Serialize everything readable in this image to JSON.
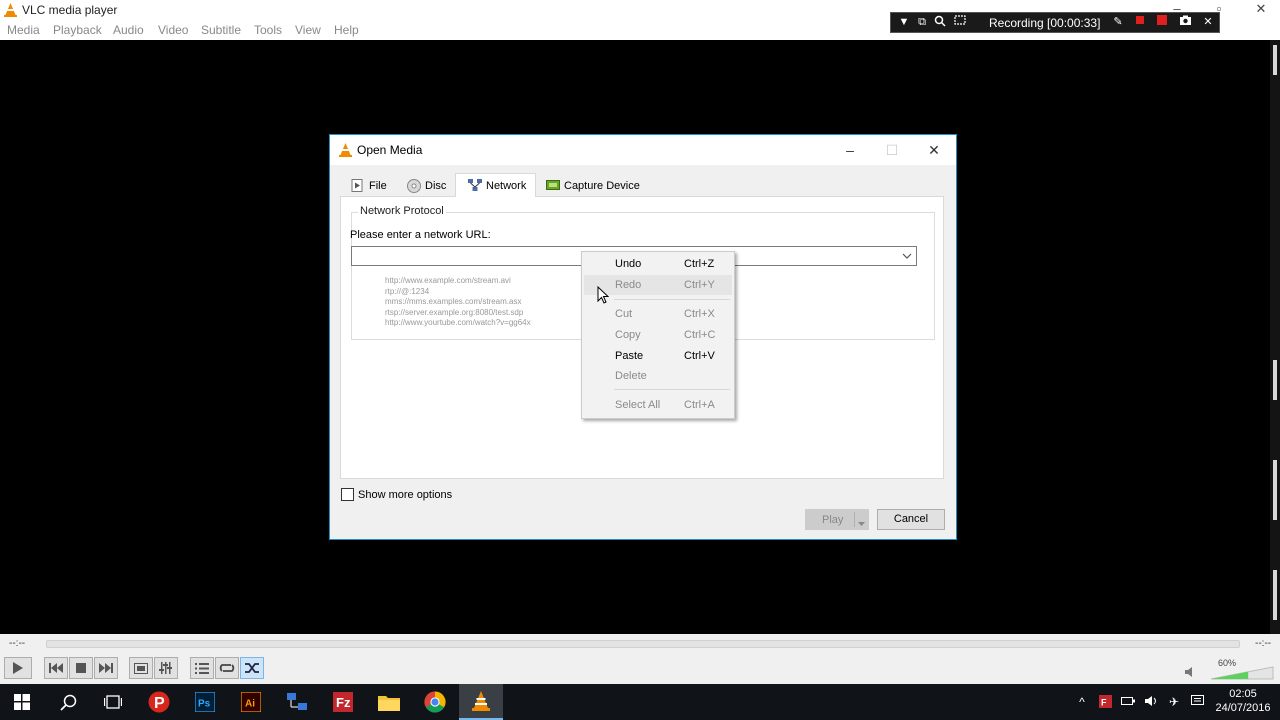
{
  "main_window": {
    "title": "VLC media player",
    "menu": [
      "Media",
      "Playback",
      "Audio",
      "Video",
      "Subtitle",
      "Tools",
      "View",
      "Help"
    ]
  },
  "recorder": {
    "status": "Recording [00:00:33]",
    "icons": [
      "dropdown-icon",
      "restore-icon",
      "zoom-icon",
      "screen-icon",
      "pen-icon",
      "stop-icon",
      "record-icon",
      "camera-icon",
      "close-icon"
    ]
  },
  "playback": {
    "time_elapsed": "--:--",
    "time_total": "--:--",
    "volume_label": "60%",
    "volume_level": 0.6
  },
  "dialog": {
    "title": "Open Media",
    "tabs": [
      {
        "label": "File",
        "icon": "file-icon"
      },
      {
        "label": "Disc",
        "icon": "disc-icon"
      },
      {
        "label": "Network",
        "icon": "network-icon",
        "active": true
      },
      {
        "label": "Capture Device",
        "icon": "capture-device-icon"
      }
    ],
    "group_title": "Network Protocol",
    "url_label": "Please enter a network URL:",
    "url_value": "",
    "examples": [
      "http://www.example.com/stream.avi",
      "rtp://@:1234",
      "mms://mms.examples.com/stream.asx",
      "rtsp://server.example.org:8080/test.sdp",
      "http://www.yourtube.com/watch?v=gg64x"
    ],
    "show_more_label": "Show more options",
    "show_more_checked": false,
    "play_label": "Play",
    "cancel_label": "Cancel"
  },
  "context_menu": {
    "items": [
      {
        "label": "Undo",
        "shortcut": "Ctrl+Z",
        "enabled": true
      },
      {
        "label": "Redo",
        "shortcut": "Ctrl+Y",
        "enabled": false
      },
      {
        "label": "Cut",
        "shortcut": "Ctrl+X",
        "enabled": false
      },
      {
        "label": "Copy",
        "shortcut": "Ctrl+C",
        "enabled": false
      },
      {
        "label": "Paste",
        "shortcut": "Ctrl+V",
        "enabled": true
      },
      {
        "label": "Delete",
        "shortcut": "",
        "enabled": false
      },
      {
        "label": "Select All",
        "shortcut": "Ctrl+A",
        "enabled": false
      }
    ]
  },
  "taskbar": {
    "apps": [
      "start-icon",
      "search-icon",
      "task-view-icon",
      "app-p-icon",
      "photoshop-icon",
      "illustrator-icon",
      "network-app-icon",
      "filezilla-icon",
      "file-explorer-icon",
      "chrome-icon",
      "vlc-icon"
    ],
    "time": "02:05",
    "date": "24/07/2016"
  },
  "colors": {
    "accent": "#1e90c8",
    "vlc_orange": "#f08a00",
    "recorder_red": "#e01f1f"
  }
}
